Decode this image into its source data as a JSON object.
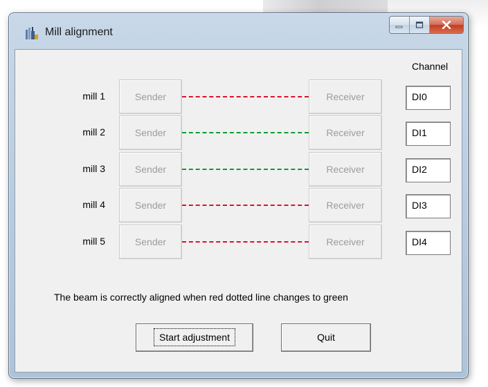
{
  "window": {
    "title": "Mill alignment"
  },
  "channel_header": "Channel",
  "mills": [
    {
      "label": "mill 1",
      "sender": "Sender",
      "receiver": "Receiver",
      "channel": "DI0",
      "beam_status": "red"
    },
    {
      "label": "mill 2",
      "sender": "Sender",
      "receiver": "Receiver",
      "channel": "DI1",
      "beam_status": "green"
    },
    {
      "label": "mill 3",
      "sender": "Sender",
      "receiver": "Receiver",
      "channel": "DI2",
      "beam_status": "green"
    },
    {
      "label": "mill 4",
      "sender": "Sender",
      "receiver": "Receiver",
      "channel": "DI3",
      "beam_status": "red"
    },
    {
      "label": "mill 5",
      "sender": "Sender",
      "receiver": "Receiver",
      "channel": "DI4",
      "beam_status": "red"
    }
  ],
  "hint_text": "The beam is correctly aligned when red dotted line changes to green",
  "buttons": {
    "start": "Start adjustment",
    "quit": "Quit"
  },
  "colors": {
    "beam_red": "#d8112c",
    "beam_green": "#0b9b34",
    "close_button": "#c23c22"
  },
  "icons": {
    "app": "mill-icon",
    "minimize": "minimize-icon",
    "maximize": "maximize-icon",
    "close": "close-icon"
  }
}
